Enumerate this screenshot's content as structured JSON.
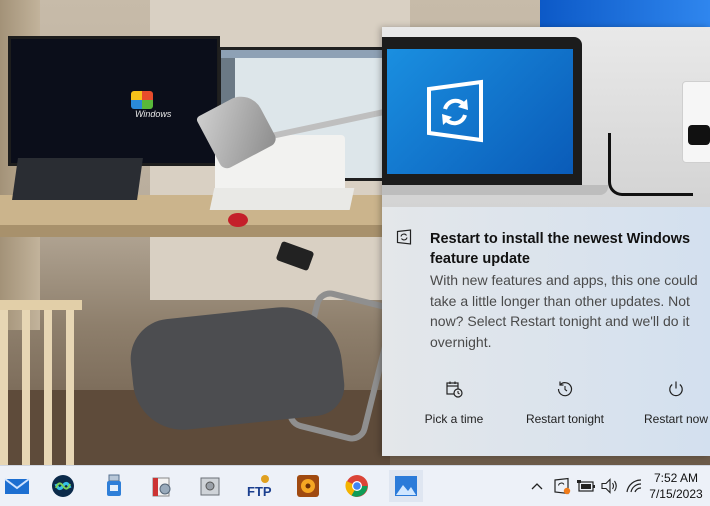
{
  "toast": {
    "title": "Restart to install the newest Windows feature update",
    "body": "With new features and apps, this one could take a little longer than other updates. Not now? Select Restart tonight and we'll do it overnight.",
    "actions": [
      {
        "label": "Pick a time",
        "icon": "calendar-clock-icon"
      },
      {
        "label": "Restart tonight",
        "icon": "restart-icon"
      },
      {
        "label": "Restart now",
        "icon": "power-icon"
      }
    ]
  },
  "background": {
    "monitor_logo_text": "Windows"
  },
  "hero": {
    "laptop_brand": "Lenovo-style laptop with Windows update logo"
  },
  "taskbar": {
    "apps": [
      {
        "name": "Mail",
        "icon": "mail-icon"
      },
      {
        "name": "Webex",
        "icon": "webex-icon"
      },
      {
        "name": "USB tool",
        "icon": "usb-icon"
      },
      {
        "name": "Installer",
        "icon": "installer-icon"
      },
      {
        "name": "Safe",
        "icon": "safe-icon"
      },
      {
        "name": "FTP",
        "icon": "ftp-icon",
        "label": "FTP"
      },
      {
        "name": "Media",
        "icon": "media-icon"
      },
      {
        "name": "Chrome",
        "icon": "chrome-icon"
      },
      {
        "name": "Photos",
        "icon": "photos-icon",
        "active": true
      }
    ],
    "tray": [
      "chevron-up-icon",
      "update-status-icon",
      "battery-icon",
      "volume-icon",
      "wifi-icon"
    ],
    "time": "7:52 AM",
    "date": "7/15/2023"
  },
  "colors": {
    "taskbar_bg": "#edf1f8",
    "toast_bg": "#e4e7ea",
    "accent_blue": "#0a5bb8"
  }
}
